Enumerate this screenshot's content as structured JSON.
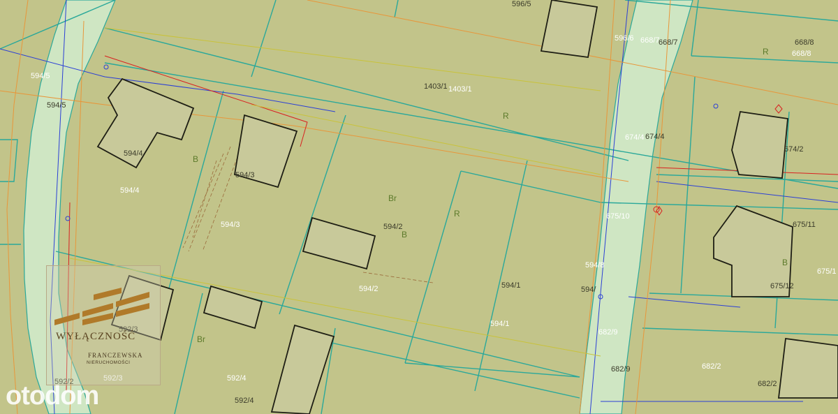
{
  "map": {
    "plots": [
      {
        "id": "p1403-1a",
        "label": "1403/1",
        "style": "dark"
      },
      {
        "id": "p1403-1b",
        "label": "1403/1",
        "style": "white"
      },
      {
        "id": "p596-5",
        "label": "596/5",
        "style": "dark"
      },
      {
        "id": "p596-6",
        "label": "596/6",
        "style": "white"
      },
      {
        "id": "p668-7a",
        "label": "668/7",
        "style": "white"
      },
      {
        "id": "p668-7b",
        "label": "668/7",
        "style": "dark"
      },
      {
        "id": "p668-8a",
        "label": "668/8",
        "style": "dark"
      },
      {
        "id": "p668-8b",
        "label": "668/8",
        "style": "white"
      },
      {
        "id": "p594-5a",
        "label": "594/5",
        "style": "white"
      },
      {
        "id": "p594-5b",
        "label": "594/5",
        "style": "dark"
      },
      {
        "id": "p594-4a",
        "label": "594/4",
        "style": "dark"
      },
      {
        "id": "p594-4b",
        "label": "594/4",
        "style": "white"
      },
      {
        "id": "p594-3a",
        "label": "594/3",
        "style": "dark"
      },
      {
        "id": "p594-3b",
        "label": "594/3",
        "style": "white"
      },
      {
        "id": "p594-2a",
        "label": "594/2",
        "style": "dark"
      },
      {
        "id": "p594-2b",
        "label": "594/2",
        "style": "white"
      },
      {
        "id": "p594-1a",
        "label": "594/1",
        "style": "dark"
      },
      {
        "id": "p594-1b",
        "label": "594/1",
        "style": "white"
      },
      {
        "id": "p674-4a",
        "label": "674/4",
        "style": "white"
      },
      {
        "id": "p674-4b",
        "label": "674/4",
        "style": "dark"
      },
      {
        "id": "p674-2",
        "label": "674/2",
        "style": "dark"
      },
      {
        "id": "p675-10",
        "label": "675/10",
        "style": "white"
      },
      {
        "id": "p675-11",
        "label": "675/11",
        "style": "dark"
      },
      {
        "id": "p675-12",
        "label": "675/12",
        "style": "dark"
      },
      {
        "id": "p675-1",
        "label": "675/1",
        "style": "white"
      },
      {
        "id": "p594-8",
        "label": "594/8",
        "style": "white"
      },
      {
        "id": "p594-x",
        "label": "594/",
        "style": "dark"
      },
      {
        "id": "p682-9a",
        "label": "682/9",
        "style": "white"
      },
      {
        "id": "p682-9b",
        "label": "682/9",
        "style": "dark"
      },
      {
        "id": "p682-2a",
        "label": "682/2",
        "style": "white"
      },
      {
        "id": "p682-2b",
        "label": "682/2",
        "style": "dark"
      },
      {
        "id": "p592-3a",
        "label": "592/3",
        "style": "dark"
      },
      {
        "id": "p592-3b",
        "label": "592/3",
        "style": "white"
      },
      {
        "id": "p592-4a",
        "label": "592/4",
        "style": "white"
      },
      {
        "id": "p592-4b",
        "label": "592/4",
        "style": "dark"
      },
      {
        "id": "p592-2",
        "label": "592/2",
        "style": "dark"
      }
    ],
    "land_use": [
      "R",
      "B",
      "Br",
      "R",
      "Br",
      "B",
      "R",
      "B"
    ]
  },
  "badge": {
    "title": "WYŁĄCZNOŚĆ",
    "brand": "FRANCZEWSKA",
    "subtitle": "NIERUCHOMOŚCI"
  },
  "watermark": "otodom",
  "colors": {
    "field": "#c2c48a",
    "road": "#cfe6c3",
    "parcel_line": "#2aa89a",
    "building_edge": "#1e1e14",
    "utility_blue": "#2b3fd6",
    "utility_orange": "#e8963a",
    "utility_red": "#d92020",
    "badge_gold": "#b07a2a"
  }
}
